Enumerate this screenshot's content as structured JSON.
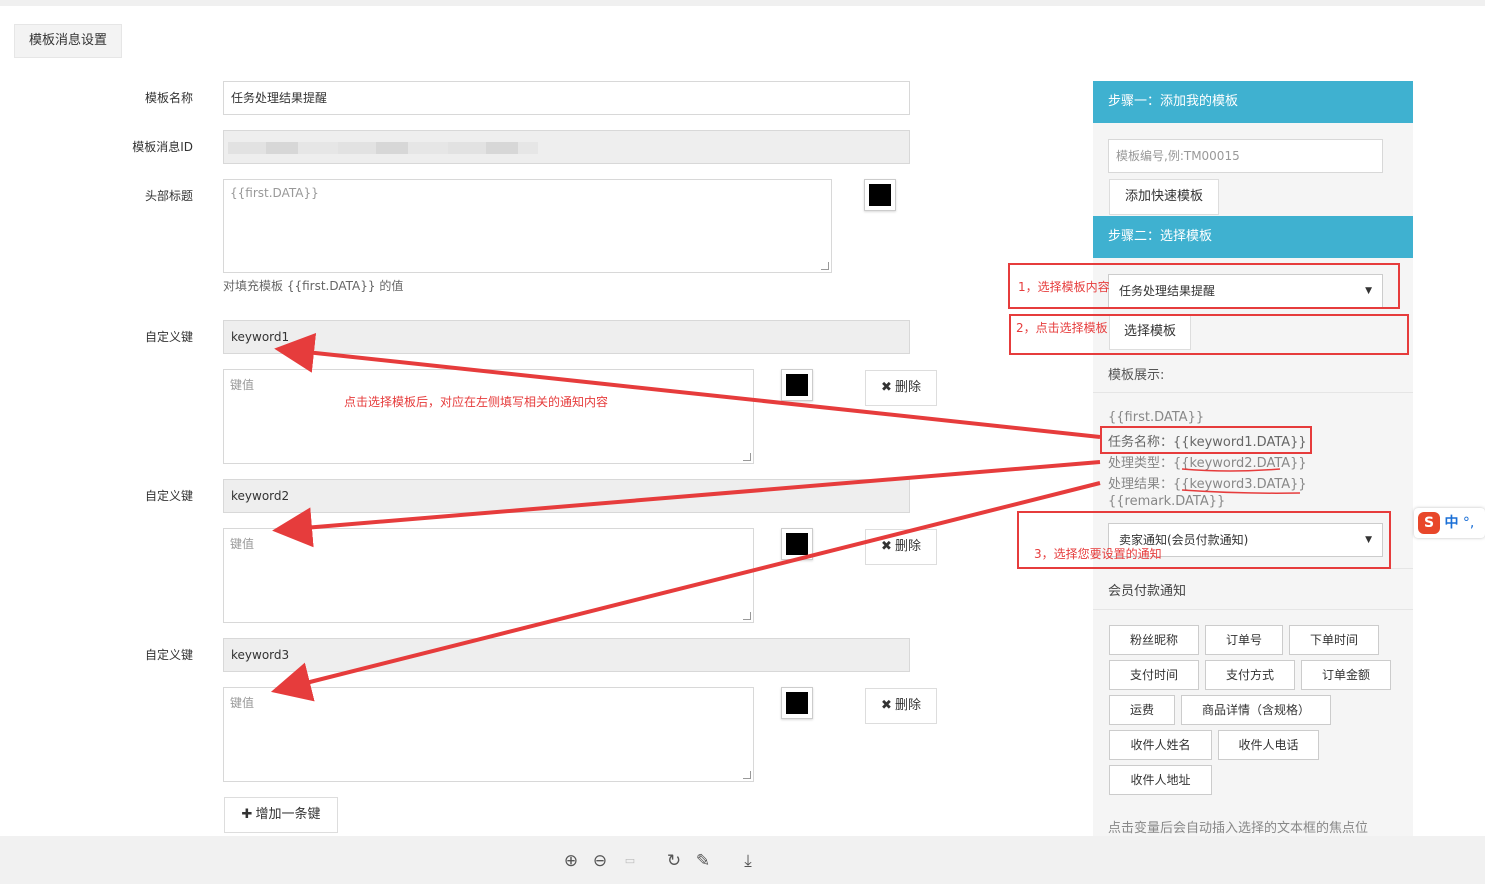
{
  "tab_title": "模板消息设置",
  "form": {
    "template_name_label": "模板名称",
    "template_name_value": "任务处理结果提醒",
    "template_id_label": "模板消息ID",
    "header_label": "头部标题",
    "header_placeholder": "{{first.DATA}}",
    "header_hint": "对填充模板 {{first.DATA}} 的值",
    "keys": [
      {
        "label": "自定义键",
        "key": "keyword1",
        "value_placeholder": "键值",
        "delete": "删除"
      },
      {
        "label": "自定义键",
        "key": "keyword2",
        "value_placeholder": "键值",
        "delete": "删除"
      },
      {
        "label": "自定义键",
        "key": "keyword3",
        "value_placeholder": "键值",
        "delete": "删除"
      }
    ],
    "add_key_label": "增加一条键"
  },
  "panel": {
    "step1_title": "步骤一：添加我的模板",
    "template_no_placeholder": "模板编号,例:TM00015",
    "add_quick_template": "添加快速模板",
    "step2_title": "步骤二：选择模板",
    "template_select_value": "任务处理结果提醒",
    "select_template_button": "选择模板",
    "template_display_label": "模板展示:",
    "template_lines": [
      "{{first.DATA}}",
      "任务名称：{{keyword1.DATA}}",
      "处理类型：{{keyword2.DATA}}",
      "处理结果：{{keyword3.DATA}}",
      "{{remark.DATA}}"
    ],
    "notice_select_value": "卖家通知(会员付款通知)",
    "notice_title": "会员付款通知",
    "variables": [
      "粉丝昵称",
      "订单号",
      "下单时间",
      "支付时间",
      "支付方式",
      "订单金额",
      "运费",
      "商品详情（含规格）",
      "收件人姓名",
      "收件人电话",
      "收件人地址"
    ],
    "footer_hint": "点击变量后会自动插入选择的文本框的焦点位"
  },
  "annotations": {
    "a1": "1，选择模板内容",
    "a2": "2，点击选择模板",
    "a3": "3，选择您要设置的通知",
    "center": "点击选择模板后，对应在左侧填写相关的通知内容"
  },
  "ime": {
    "brand": "S",
    "mode": "中",
    "punct": "°,"
  },
  "colors": {
    "accent": "#3fb1d0",
    "annotation_red": "#e63c3c"
  }
}
